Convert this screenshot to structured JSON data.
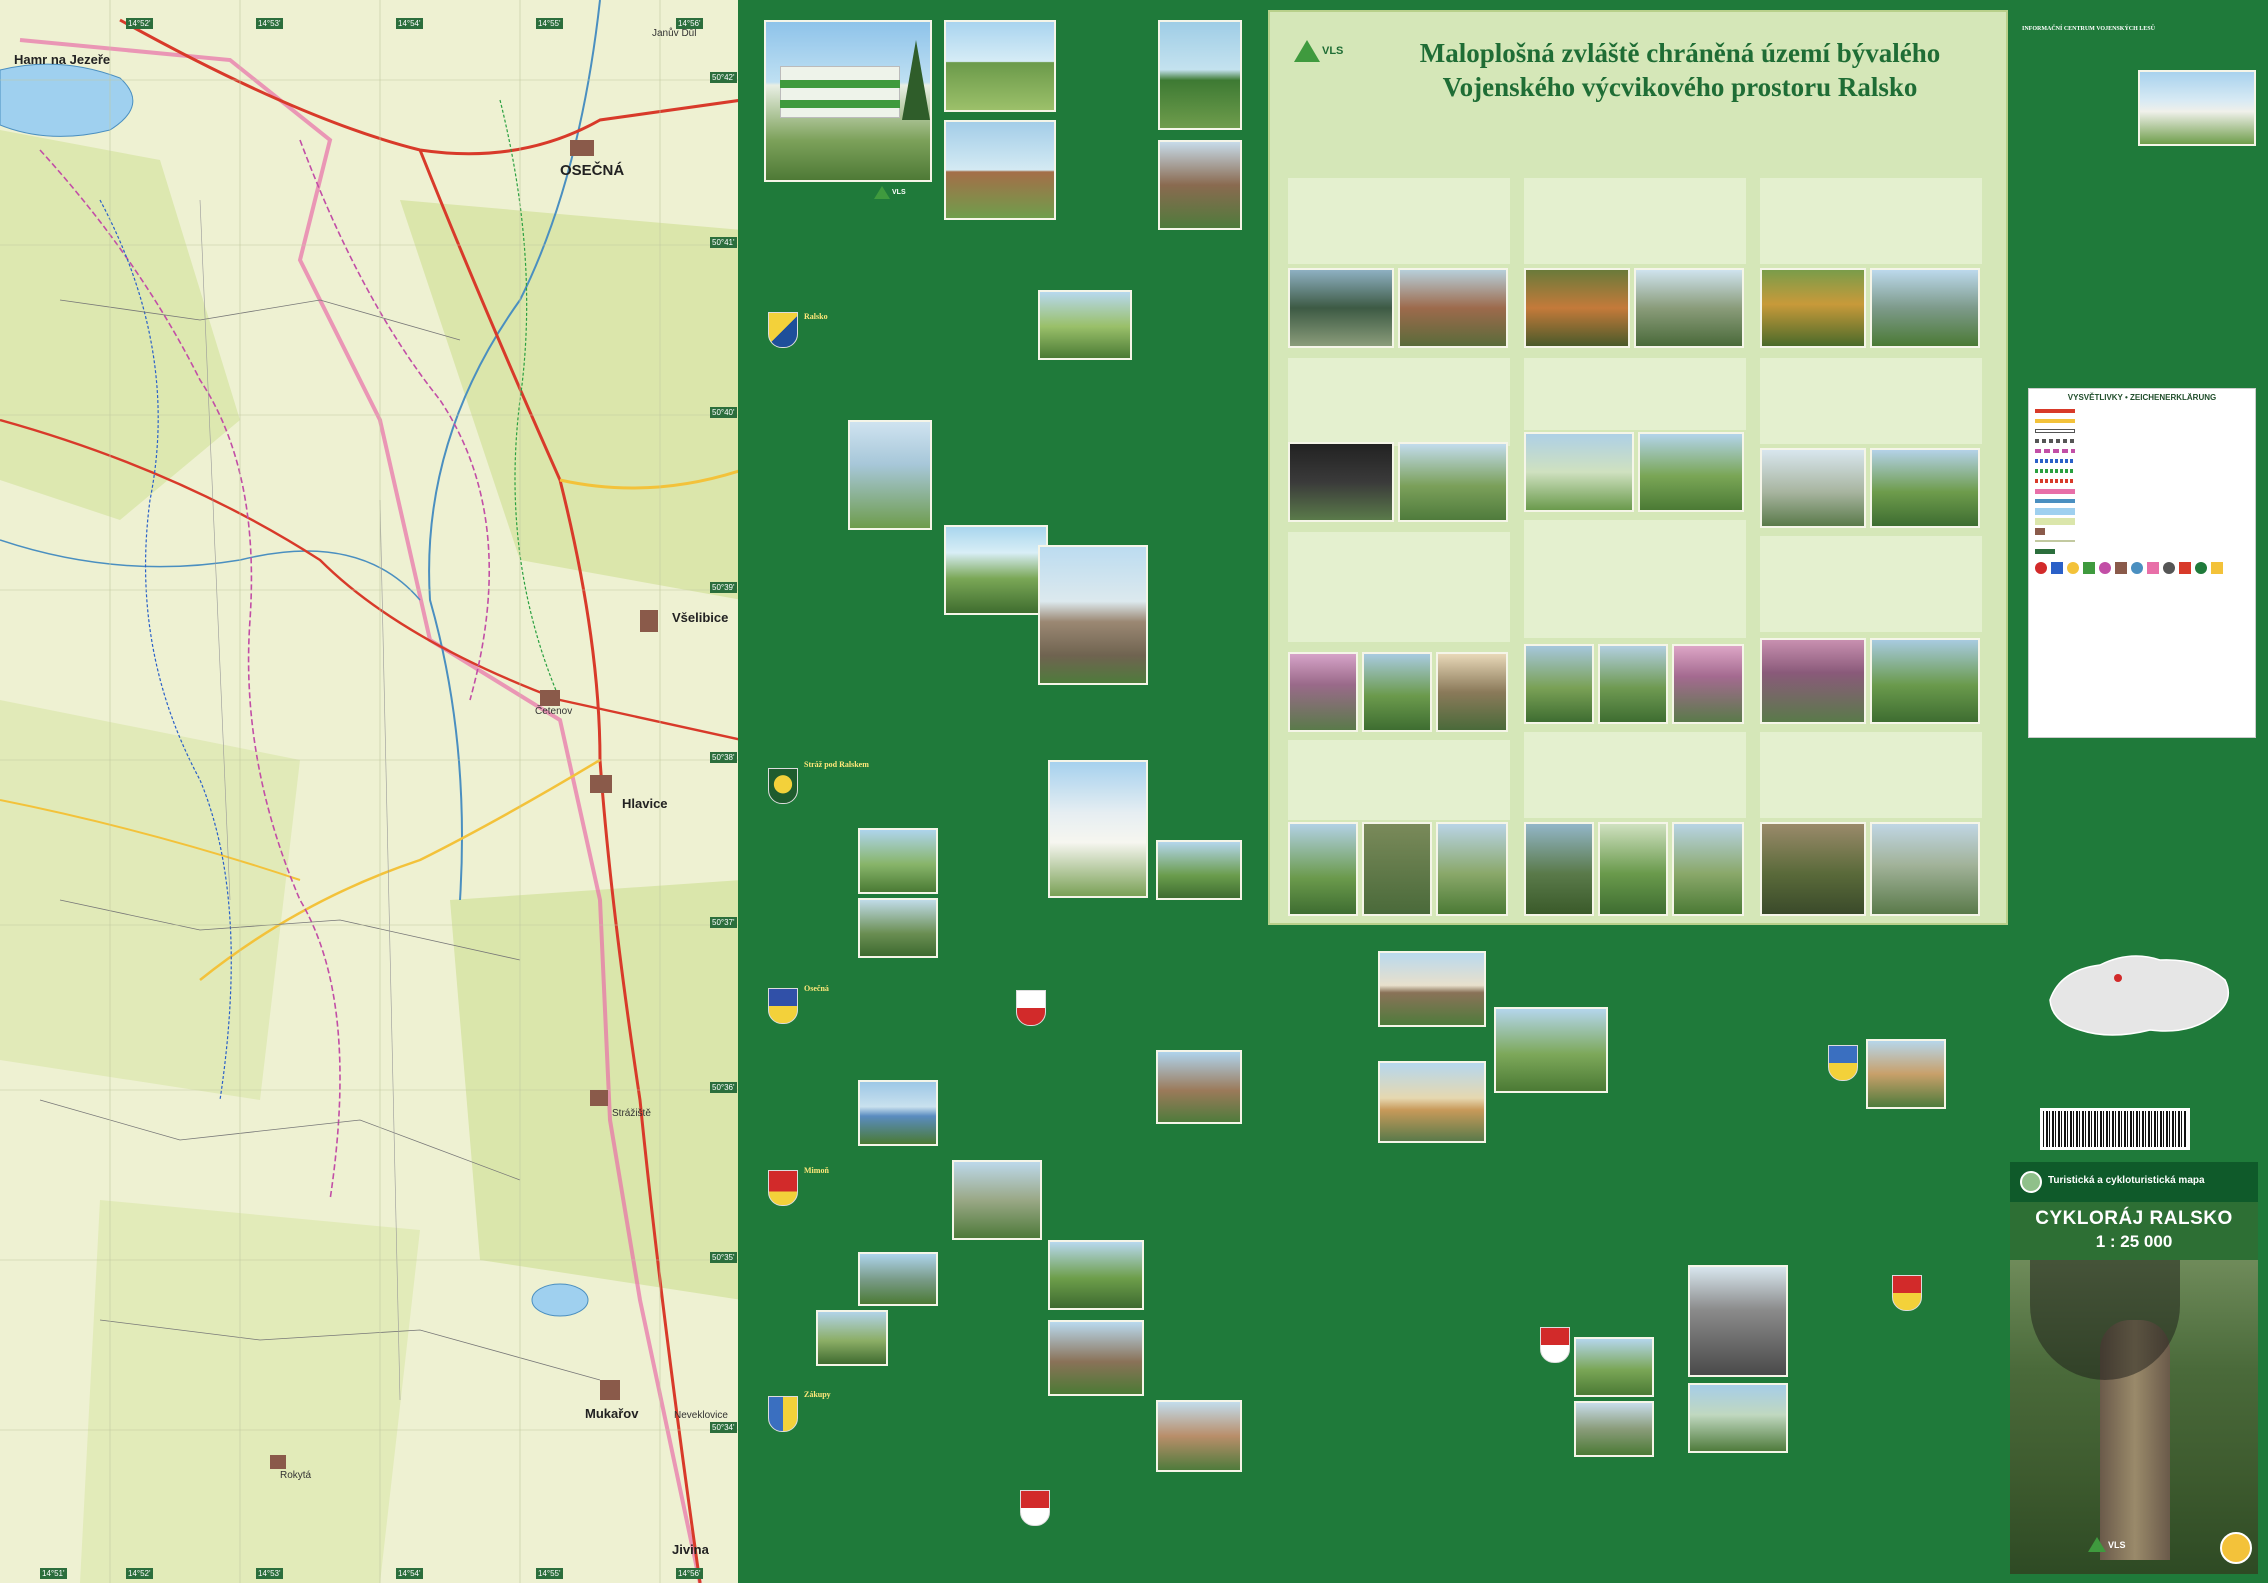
{
  "map": {
    "towns": {
      "hamr": "Hamr na Jezeře",
      "janov": "Janův Důl",
      "osecna": "OSEČNÁ",
      "vselibice": "Všelibice",
      "cetenov": "Četenov",
      "hlavice": "Hlavice",
      "strazista": "Strážiště",
      "mukarov": "Mukařov",
      "neveklovice": "Neveklovice",
      "rokyta": "Rokytá",
      "jivina": "Jivina"
    },
    "grid_top": [
      "14°52'",
      "14°53'",
      "14°54'",
      "14°55'",
      "14°56'"
    ],
    "grid_side": [
      "50°42'",
      "50°41'",
      "50°40'",
      "50°39'",
      "50°38'",
      "50°37'",
      "50°36'",
      "50°35'",
      "50°34'"
    ],
    "grid_bottom": [
      "14°51'",
      "14°52'",
      "14°53'",
      "14°54'",
      "14°55'",
      "14°56'"
    ]
  },
  "info": {
    "logo_text": "VLS",
    "title_line1": "Maloplošná zvláště chráněná území bývalého",
    "title_line2": "Vojenského výcvikového prostoru Ralsko"
  },
  "towns_panel": {
    "sections": [
      "Ralsko",
      "Stráž pod Ralskem",
      "Osečná",
      "Mimoň",
      "Zákupy"
    ]
  },
  "right": {
    "ic_title": "INFORMAČNÍ CENTRUM VOJENSKÝCH LESŮ",
    "legend_title": "VYSVĚTLIVKY • ZEICHENERKLÄRUNG",
    "cover_sub": "Turistická a cykloturistická mapa",
    "cover_title": "CYKLORÁJ RALSKO",
    "cover_scale": "1 : 25 000",
    "cover_logo": "VLS"
  },
  "colors": {
    "panel_green": "#1f7a3a",
    "info_bg": "#d5e7b8",
    "title_green": "#1f6d35",
    "map_bg": "#eef1d2"
  }
}
